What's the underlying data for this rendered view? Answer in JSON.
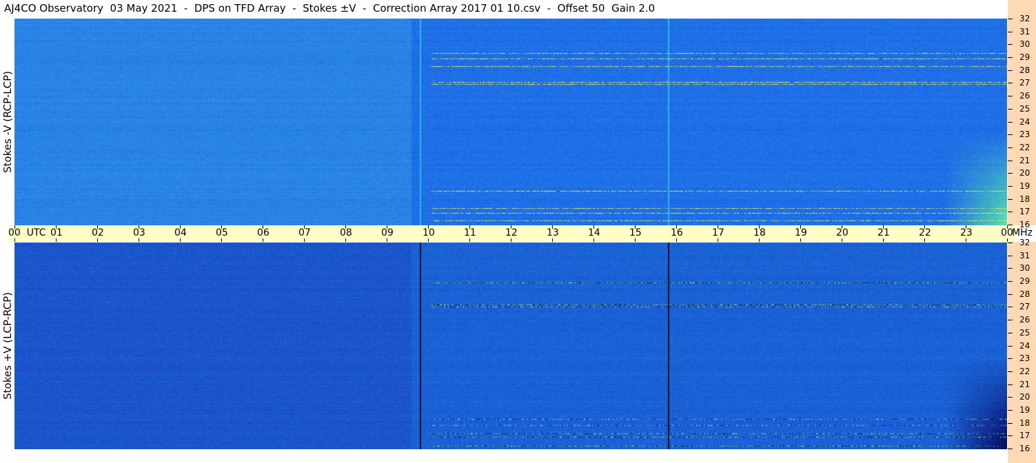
{
  "title": "AJ4CO Observatory  03 May 2021  -  DPS on TFD Array  -  Stokes ±V  -  Correction Array 2017 01 10.csv  -  Offset 50  Gain 2.0",
  "chart_data": {
    "type": "heatmap",
    "panels": [
      {
        "ylabel": "Stokes -V (RCP-LCP)",
        "y_ticks": [
          "32",
          "31",
          "30",
          "29",
          "28",
          "27",
          "26",
          "25",
          "24",
          "23",
          "22",
          "21",
          "20",
          "19",
          "18",
          "17",
          "16"
        ],
        "ylim_mhz": [
          16,
          32
        ],
        "background_color": "#1f6fe6",
        "spike_color": "#29b6f6",
        "bright_bands_mhz": [
          16.3,
          16.9,
          17.3,
          18.6,
          26.9,
          27.1,
          28.3,
          28.9,
          29.3
        ],
        "hot_region_utc": [
          22.5,
          24
        ]
      },
      {
        "ylabel": "Stokes +V (LCP-RCP)",
        "y_ticks": [
          "32",
          "31",
          "30",
          "29",
          "28",
          "27",
          "26",
          "25",
          "24",
          "23",
          "22",
          "21",
          "20",
          "19",
          "18",
          "17",
          "16"
        ],
        "ylim_mhz": [
          16,
          32
        ],
        "background_color": "#1b62d6",
        "spike_color": "#0a0a14",
        "bright_bands_mhz": [
          16.2,
          16.9,
          17.2,
          17.8,
          18.3,
          27.0,
          27.2,
          28.9
        ],
        "hot_region_utc": [
          22.5,
          24
        ]
      }
    ],
    "x_ticks": [
      "00  UTC",
      "01",
      "02",
      "03",
      "04",
      "05",
      "06",
      "07",
      "08",
      "09",
      "10",
      "11",
      "12",
      "13",
      "14",
      "15",
      "16",
      "17",
      "18",
      "19",
      "20",
      "21",
      "22",
      "23",
      "00"
    ],
    "x_unit_label": "MHz",
    "xlim_utc": [
      0,
      24
    ],
    "vertical_spikes_utc": [
      9.8,
      15.8
    ],
    "colors": {
      "axis_band": "#ffffc8",
      "freq_band": "#ffd9b3"
    }
  }
}
